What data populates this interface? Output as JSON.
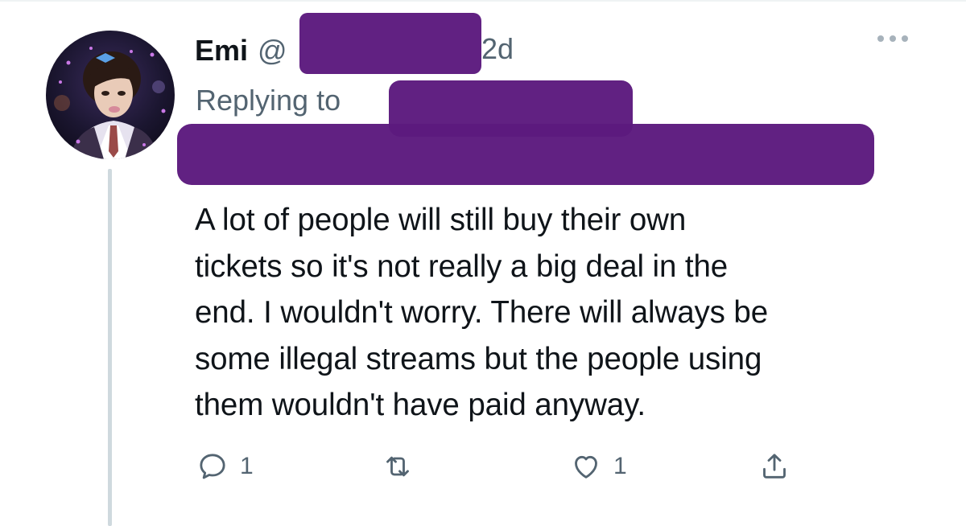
{
  "tweet": {
    "author": {
      "display_name": "Emi",
      "handle_prefix": "@"
    },
    "timestamp": "2d",
    "replying_to_label": "Replying to",
    "text_lines": [
      "A lot of people will still buy their own",
      "tickets so it's not really a big deal in the",
      "end. I wouldn't worry. There will always be",
      "some illegal streams but the people using",
      "them wouldn't have paid anyway."
    ],
    "actions": {
      "reply_count": "1",
      "like_count": "1"
    }
  },
  "icons": {
    "more": "more-dots-icon",
    "reply": "reply-bubble-icon",
    "retweet": "retweet-icon",
    "like": "heart-icon",
    "share": "share-icon"
  },
  "colors": {
    "text": "#0f1419",
    "secondary": "#536471",
    "redaction": "#5c1a7e",
    "thread_line": "#cfd9de"
  }
}
